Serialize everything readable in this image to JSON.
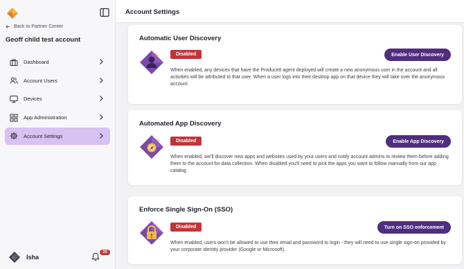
{
  "sidebar": {
    "back_link": "Back to Partner Center",
    "account_name": "Geoff child test account",
    "items": [
      {
        "label": "Dashboard",
        "icon": "briefcase-icon"
      },
      {
        "label": "Account Users",
        "icon": "users-icon"
      },
      {
        "label": "Devices",
        "icon": "monitor-icon"
      },
      {
        "label": "App Administration",
        "icon": "grid-icon"
      },
      {
        "label": "Account Settings",
        "icon": "gear-icon",
        "active": true
      }
    ],
    "user_name": "Isha",
    "notification_count": "20"
  },
  "header": {
    "title": "Account Settings"
  },
  "cards": [
    {
      "title": "Automatic User Discovery",
      "status": "Disabled",
      "button": "Enable User Discovery",
      "description": "When enabled, any devices that have the Produce8 agent deployed will create a new anonymous user in the account and all activities will be attributed to that user. When a user logs into their desktop app on that device they will take over the anonymous account.",
      "icon": "user-discovery-icon"
    },
    {
      "title": "Automated App Discovery",
      "status": "Disabled",
      "button": "Enable App Discovery",
      "description": "When enabled, we'll discover new apps and websites used by your users and notify account admins to review them before adding them to the account for data collection. When disabled you'll need to pick the apps you want to follow manually from our app catalog.",
      "icon": "app-discovery-icon"
    },
    {
      "title": "Enforce Single Sign-On (SSO)",
      "status": "Disabled",
      "button": "Turn on SSO enforcement",
      "description": "When enabled, users won't be allowed to use their email and password to login - they will need to use single sign-on provided by your corporate identity provider (Google or Microsoft).",
      "icon": "lock-icon"
    }
  ],
  "colors": {
    "accent": "#4f2d7f",
    "active_nav": "#d7c2f2",
    "status_disabled": "#c0353a",
    "logo_orange": "#f59a2a"
  }
}
